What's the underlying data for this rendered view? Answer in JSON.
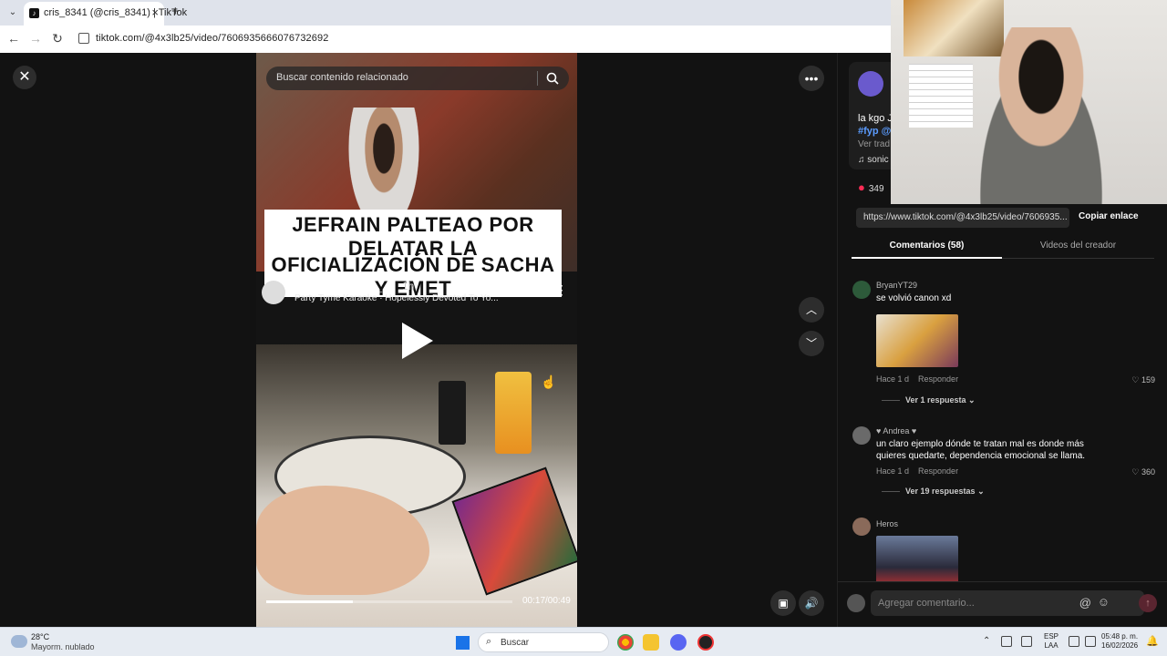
{
  "browser": {
    "tab_title": "cris_8341 (@cris_8341) | TikTok",
    "url": "tiktok.com/@4x3lb25/video/7606935666076732692"
  },
  "video": {
    "search_placeholder": "Buscar contenido relacionado",
    "caption_line1": "JEFRAIN PALTEAO POR DELATAR LA",
    "caption_line2": "OFICIALIZACIÓN DE SACHA Y EMET",
    "story_user": "sachauzumaki_",
    "story_time": "1h",
    "story_music": "Party Tyme Karaoke · Hopelessly Devoted To Yo...",
    "time": "00:17/00:49",
    "progress": 0.35
  },
  "panel": {
    "desc_text": "la kgo J",
    "desc_tag": "#fyp @",
    "desc_more": "Ver trad",
    "desc_music": "sonic",
    "likes": "349",
    "link": "https://www.tiktok.com/@4x3lb25/video/7606935...",
    "copy_label": "Copiar enlace",
    "tab_comments": "Comentarios (58)",
    "tab_creator": "Videos del creador",
    "comments": [
      {
        "user": "BryanYT29",
        "text": "se volvió canon xd",
        "time": "Hace 1 d",
        "reply": "Responder",
        "likes": "159",
        "replies": "Ver 1 respuesta"
      },
      {
        "user": "♥ Andrea ♥",
        "text": "un claro ejemplo dónde te tratan mal es donde más quieres quedarte, dependencia emocional se llama.",
        "time": "Hace 1 d",
        "reply": "Responder",
        "likes": "360",
        "replies": "Ver 19 respuestas"
      },
      {
        "user": "Heros"
      }
    ],
    "add_placeholder": "Agregar comentario..."
  },
  "taskbar": {
    "temp": "28°C",
    "weather": "Mayorm. nublado",
    "search": "Buscar",
    "lang1": "ESP",
    "lang2": "LAA",
    "time": "05:48 p. m.",
    "date": "16/02/2026"
  },
  "icons": {
    "close": "close-icon",
    "more": "more-icon",
    "search": "search-icon",
    "play": "play-icon",
    "heart": "heart-icon"
  }
}
